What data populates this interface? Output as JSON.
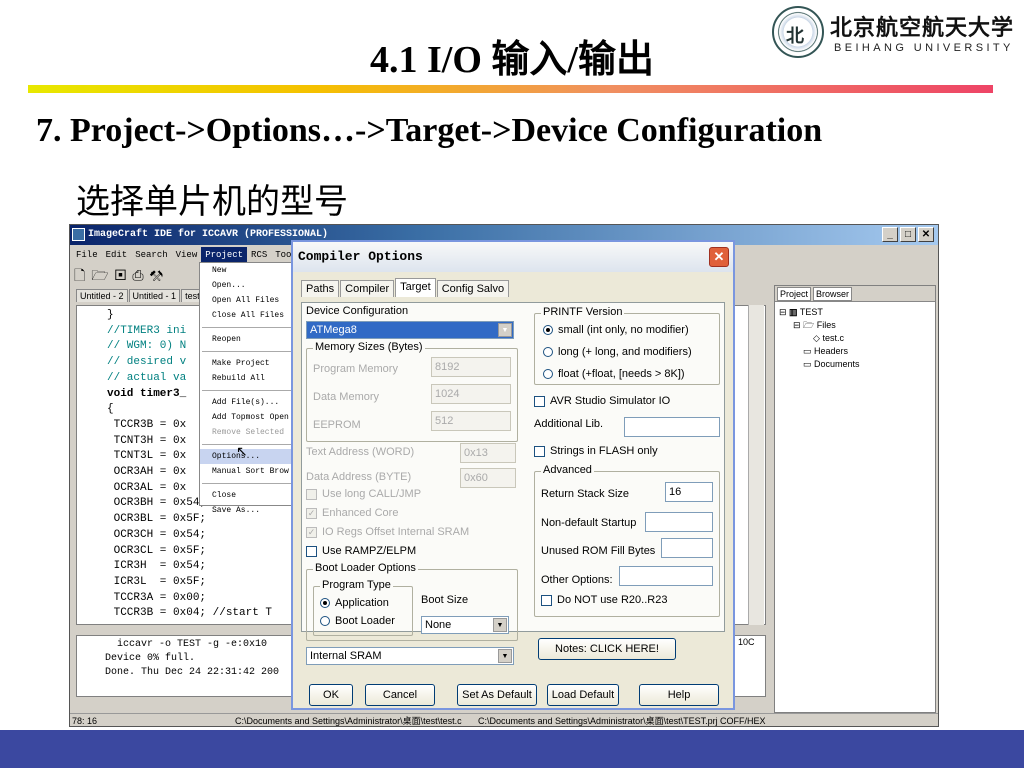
{
  "slide": {
    "title": "4.1 I/O 输入/输出",
    "line1": "7. Project->Options…->Target->Device Configuration",
    "line2": "选择单片机的型号",
    "logo_cn": "北京航空航天大学",
    "logo_en": "BEIHANG UNIVERSITY",
    "colors": {
      "footer": "#3b48a0",
      "title_bar": "#0a246a"
    }
  },
  "ide": {
    "title": "ImageCraft IDE for ICCAVR (PROFESSIONAL)",
    "menu": [
      "File",
      "Edit",
      "Search",
      "View",
      "Project",
      "RCS",
      "Tools"
    ],
    "tabs": [
      "Untitled - 2",
      "Untitled - 1",
      "test"
    ],
    "code": [
      "}",
      "",
      "//TIMER3 ini",
      "// WGM: 0) N",
      "// desired v",
      "// actual va",
      "void timer3_",
      "{",
      " TCCR3B = 0x",
      " TCNT3H = 0x",
      " TCNT3L = 0x",
      " OCR3AH = 0x",
      " OCR3AL = 0x",
      " OCR3BH = 0x54;",
      " OCR3BL = 0x5F;",
      " OCR3CH = 0x54;",
      " OCR3CL = 0x5F;",
      " ICR3H  = 0x54;",
      " ICR3L  = 0x5F;",
      " TCCR3A = 0x00;",
      " TCCR3B = 0x04; //start T"
    ],
    "output": [
      "  iccavr -o TEST -g -e:0x10",
      "Device 0% full.",
      "Done. Thu Dec 24 22:31:42 200"
    ],
    "status": {
      "pos": "78: 16",
      "path1": "C:\\Documents and Settings\\Administrator\\桌面\\test\\test.c",
      "path2": "C:\\Documents and Settings\\Administrator\\桌面\\test\\TEST.prj",
      "format": "COFF/HEX"
    },
    "right_panel": {
      "tabs": [
        "Project",
        "Browser"
      ],
      "tree": [
        "TEST",
        "Files",
        "test.c",
        "Headers",
        "Documents"
      ]
    },
    "output_tail": "10C"
  },
  "project_menu": {
    "items": [
      "New",
      "Open...",
      "Open All Files",
      "Close All Files",
      "Reopen",
      "Make Project",
      "Rebuild All",
      "Add File(s)...",
      "Add Topmost Open",
      "Remove Selected",
      "Options...",
      "Manual Sort Brow",
      "Close",
      "Save As..."
    ]
  },
  "dialog": {
    "title": "Compiler Options",
    "tabs": [
      "Paths",
      "Compiler",
      "Target",
      "Config Salvo"
    ],
    "device_config": {
      "label": "Device Configuration",
      "value": "ATMega8"
    },
    "memory": {
      "label": "Memory Sizes (Bytes)",
      "program_label": "Program Memory",
      "program": "8192",
      "data_label": "Data Memory",
      "data": "1024",
      "eeprom_label": "EEPROM",
      "eeprom": "512"
    },
    "text_address": {
      "label": "Text Address (WORD)",
      "value": "0x13"
    },
    "data_address": {
      "label": "Data Address (BYTE)",
      "value": "0x60"
    },
    "checks_left": [
      "Use long CALL/JMP",
      "Enhanced Core",
      "IO  Regs Offset Internal SRAM",
      "Use RAMPZ/ELPM"
    ],
    "boot": {
      "label": "Boot Loader Options",
      "program_type": "Program Type",
      "application": "Application",
      "boot_loader": "Boot Loader",
      "boot_size_label": "Boot Size",
      "boot_size": "None"
    },
    "sram": "Internal SRAM",
    "printf": {
      "label": "PRINTF Version",
      "options": [
        "small (int only, no modifier)",
        "long (+ long, and modifiers)",
        "float (+float, [needs > 8K])"
      ]
    },
    "avr_studio": "AVR Studio Simulator IO",
    "additional_lib": "Additional Lib.",
    "strings_flash": "Strings in FLASH only",
    "advanced": {
      "label": "Advanced",
      "return_stack_label": "Return Stack Size",
      "return_stack": "16",
      "non_default_startup": "Non-default Startup",
      "unused_rom": "Unused ROM Fill Bytes",
      "other_options": "Other Options:",
      "no_r20": "Do NOT use R20..R23"
    },
    "notes": "Notes: CLICK HERE!",
    "buttons": {
      "ok": "OK",
      "cancel": "Cancel",
      "set_default": "Set As Default",
      "load_default": "Load Default",
      "help": "Help"
    }
  }
}
